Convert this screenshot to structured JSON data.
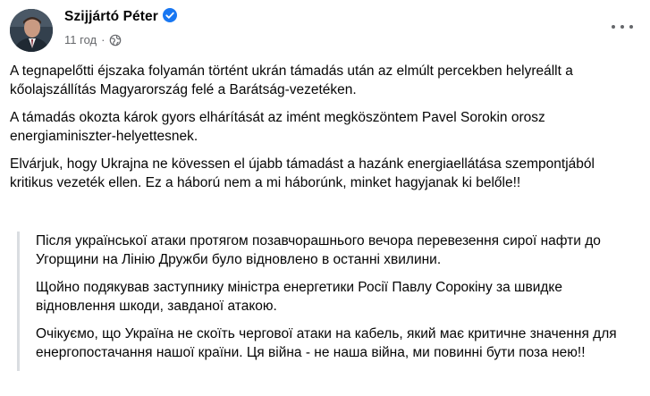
{
  "post": {
    "author": "Szijjártó Péter",
    "time": "11 год",
    "separator": "·",
    "icons": {
      "verified": "verified-badge-icon",
      "audience": "globe-icon",
      "more": "more-options-icon"
    },
    "colors": {
      "verified_badge": "#1877f2",
      "meta_text": "#65676b",
      "quote_bar": "#dadde1"
    },
    "paragraphs": [
      "A tegnapelőtti éjszaka folyamán történt ukrán támadás után az elmúlt percekben helyreállt a kőolajszállítás Magyarország felé a Barátság-vezetéken.",
      "A támadás okozta károk gyors elhárítását az imént megköszöntem Pavel Sorokin orosz energiaminiszter-helyettesnek.",
      "Elvárjuk, hogy Ukrajna ne kövessen el újabb támadást a hazánk energiaellátása szempontjából kritikus vezeték ellen. Ez a háború nem a mi háborúnk, minket hagyjanak ki belőle!!"
    ],
    "translation": [
      "Після української атаки протягом позавчорашнього вечора перевезення сирої нафти до Угорщини на Лінію Дружби було відновлено в останні хвилини.",
      "Щойно подякував заступнику міністра енергетики Росії Павлу Сорокіну за швидке відновлення шкоди, завданої атакою.",
      "Очікуємо, що Україна не скоїть чергової атаки на кабель, який має критичне значення для енергопостачання нашої країни. Ця війна - не наша війна, ми повинні бути поза нею!!"
    ]
  }
}
